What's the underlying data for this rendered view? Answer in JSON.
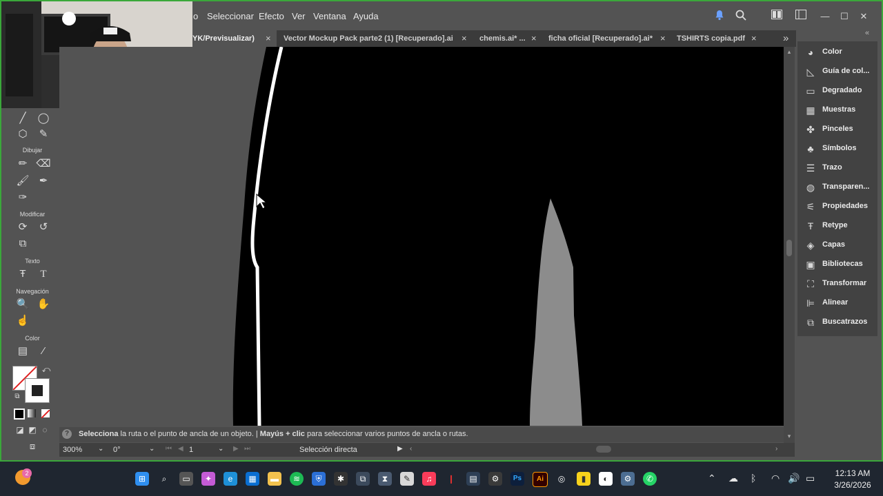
{
  "menu": {
    "items": [
      "o",
      "Seleccionar",
      "Efecto",
      "Ver",
      "Ventana",
      "Ayuda"
    ]
  },
  "window_controls": {
    "minimize": "—",
    "maximize": "☐",
    "close": "✕"
  },
  "tabs": [
    {
      "label": "YK/Previsualizar)",
      "active": true
    },
    {
      "label": "Vector Mockup Pack parte2  (1) [Recuperado].ai",
      "active": false
    },
    {
      "label": "chemis.ai* ...",
      "active": false
    },
    {
      "label": "ficha oficial [Recuperado].ai*",
      "active": false
    },
    {
      "label": "TSHIRTS copia.pdf",
      "active": false
    }
  ],
  "tabs_overflow": "»",
  "toolbar": {
    "sections": [
      "Dibujar",
      "Modificar",
      "Texto",
      "Navegación",
      "Color"
    ]
  },
  "panel": {
    "collapse": "«",
    "items": [
      {
        "label": "Color",
        "icon": "color-palette-icon"
      },
      {
        "label": "Guía de col...",
        "icon": "color-guide-icon"
      },
      {
        "label": "Degradado",
        "icon": "gradient-icon"
      },
      {
        "label": "Muestras",
        "icon": "swatches-icon"
      },
      {
        "label": "Pinceles",
        "icon": "brushes-icon"
      },
      {
        "label": "Símbolos",
        "icon": "symbols-icon"
      },
      {
        "label": "Trazo",
        "icon": "stroke-icon"
      },
      {
        "label": "Transparen...",
        "icon": "transparency-icon"
      },
      {
        "label": "Propiedades",
        "icon": "properties-icon"
      },
      {
        "label": "Retype",
        "icon": "retype-icon"
      },
      {
        "label": "Capas",
        "icon": "layers-icon"
      },
      {
        "label": "Bibliotecas",
        "icon": "libraries-icon"
      },
      {
        "label": "Transformar",
        "icon": "transform-icon"
      },
      {
        "label": "Alinear",
        "icon": "align-icon"
      },
      {
        "label": "Buscatrazos",
        "icon": "pathfinder-icon"
      }
    ]
  },
  "status": {
    "help": "?",
    "hint_bold_1": "Selecciona",
    "hint_text_1": " la ruta o el punto de ancla de un objeto.  |  ",
    "hint_bold_2": "Mayús + clic",
    "hint_text_2": " para seleccionar varios puntos de ancla o rutas."
  },
  "bottombar": {
    "zoom": "300%",
    "rotation": "0°",
    "artboard": "1",
    "tool": "Selección directa"
  },
  "taskbar": {
    "notification_badge": "2",
    "time": "12:13 AM",
    "date": "3/26/2026"
  },
  "colors": {
    "ui_bg": "#535353",
    "tab_bg": "#3b3b3b",
    "panel_bg": "#424242",
    "artwork_black": "#000000",
    "frame_green": "#3aa83a",
    "taskbar_bg": "#1f2630"
  }
}
